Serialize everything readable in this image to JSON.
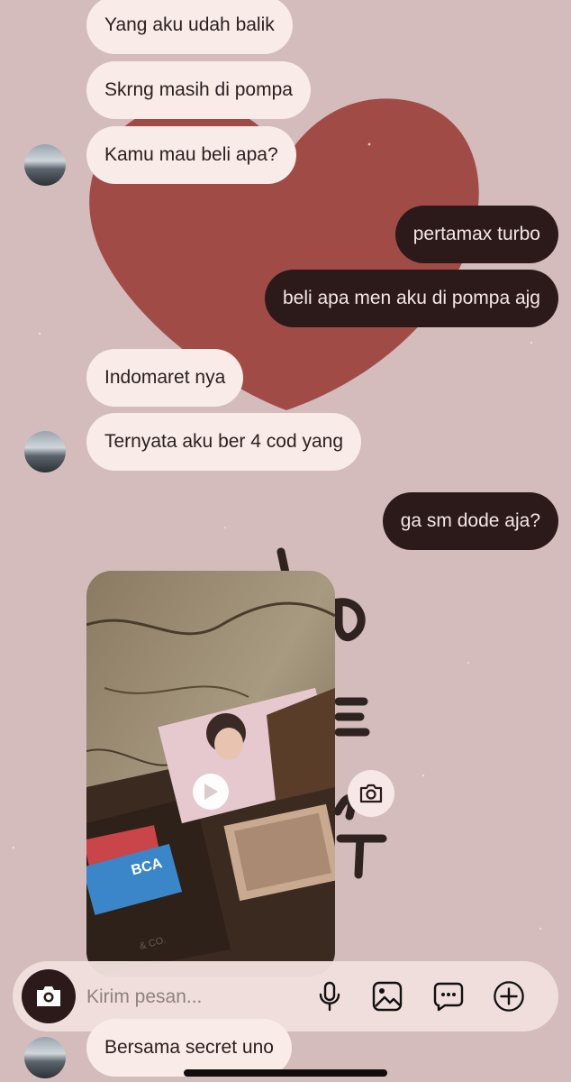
{
  "messages": [
    {
      "id": "m1",
      "side": "in",
      "text": "Yang aku udah balik"
    },
    {
      "id": "m2",
      "side": "in",
      "text": "Skrng masih di pompa"
    },
    {
      "id": "m3",
      "side": "in",
      "text": "Kamu mau beli apa?"
    },
    {
      "id": "m4",
      "side": "out",
      "text": "pertamax turbo"
    },
    {
      "id": "m5",
      "side": "out",
      "text": "beli apa men aku di pompa ajg"
    },
    {
      "id": "m6",
      "side": "in",
      "text": "Indomaret nya"
    },
    {
      "id": "m7",
      "side": "in",
      "text": "Ternyata aku ber 4 cod yang"
    },
    {
      "id": "m8",
      "side": "out",
      "text": "ga sm dode aja?"
    },
    {
      "id": "m9",
      "side": "in",
      "text": "Bersama secret uno"
    }
  ],
  "media": {
    "type": "video-reply",
    "card_brand": "BCA",
    "wallet_text": "& CO."
  },
  "composer": {
    "placeholder": "Kirim pesan..."
  },
  "icons": {
    "composer_camera": "camera-icon",
    "mic": "microphone-icon",
    "gallery": "image-icon",
    "sticker": "chat-bubble-dots-icon",
    "add": "plus-circle-icon",
    "media_camera": "camera-icon",
    "play": "play-icon"
  },
  "colors": {
    "background": "#d3bcbb",
    "incoming": "#f8ebe8",
    "outgoing": "#2b1a19",
    "heart": "#a14b47"
  }
}
